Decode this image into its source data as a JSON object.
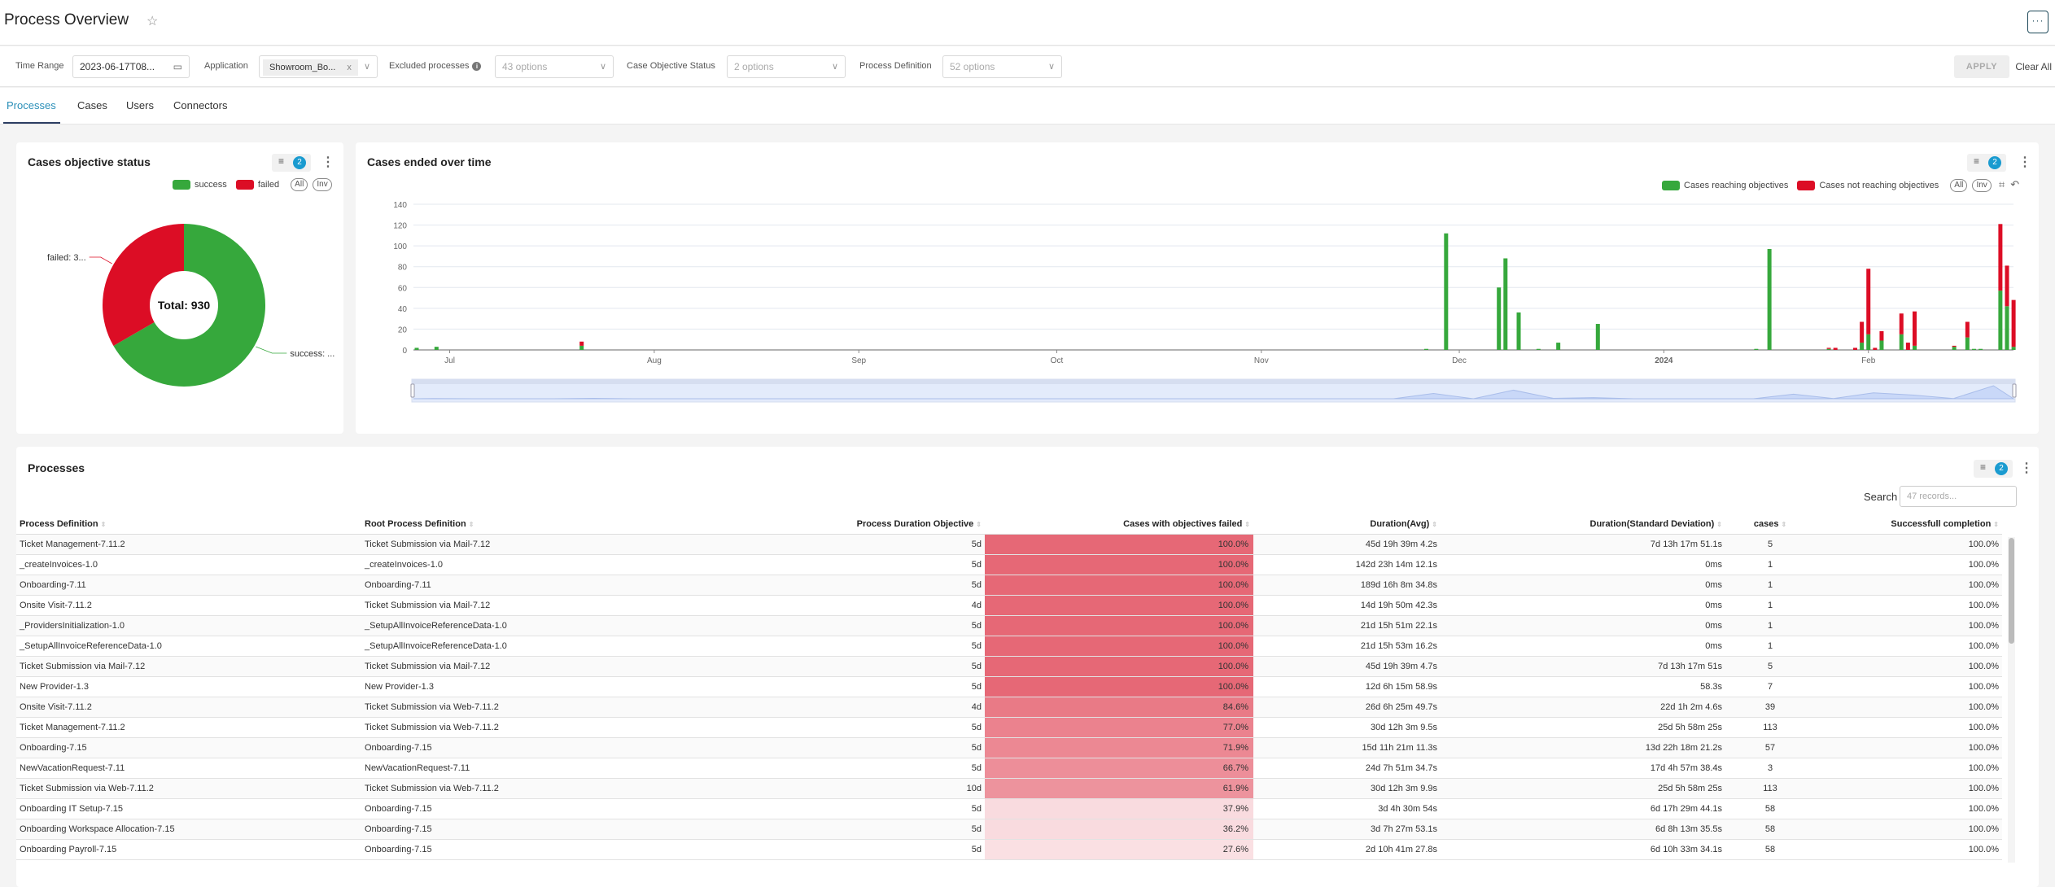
{
  "header": {
    "title": "Process Overview",
    "star_icon": "star-icon",
    "more_label": "···"
  },
  "filters": {
    "time_range": {
      "label": "Time Range",
      "value": "2023-06-17T08..."
    },
    "application": {
      "label": "Application",
      "chip": "Showroom_Bo...",
      "chip_remove": "x"
    },
    "excluded": {
      "label": "Excluded processes",
      "placeholder": "43 options"
    },
    "case_status": {
      "label": "Case Objective Status",
      "placeholder": "2 options"
    },
    "process_def": {
      "label": "Process Definition",
      "placeholder": "52 options"
    },
    "apply_label": "APPLY",
    "clear_label": "Clear All"
  },
  "tabs": [
    {
      "label": "Processes",
      "active": true
    },
    {
      "label": "Cases",
      "active": false
    },
    {
      "label": "Users",
      "active": false
    },
    {
      "label": "Connectors",
      "active": false
    }
  ],
  "objective_card": {
    "title": "Cases objective status",
    "filter_count": "2",
    "legend_all": "All",
    "legend_inv": "Inv"
  },
  "timeline_card": {
    "title": "Cases ended over time",
    "filter_count": "2",
    "legend_all": "All",
    "legend_inv": "Inv"
  },
  "chart_data": [
    {
      "type": "pie",
      "title": "Cases objective status",
      "center_label": "Total: 930",
      "legend": [
        "success",
        "failed"
      ],
      "colors": {
        "success": "#36a83c",
        "failed": "#dc0d25"
      },
      "slices": [
        {
          "name": "success",
          "value": 620,
          "label": "success: ..."
        },
        {
          "name": "failed",
          "value": 310,
          "label": "failed: 3..."
        }
      ]
    },
    {
      "type": "bar",
      "stacked": true,
      "title": "Cases ended over time",
      "xlabel": "",
      "ylabel": "",
      "ylim": [
        0,
        140
      ],
      "yticks": [
        0,
        20,
        40,
        60,
        80,
        100,
        120,
        140
      ],
      "x_range": [
        "2023-06-26",
        "2024-02-22"
      ],
      "xticks": [
        {
          "date": "2023-07-01",
          "label": "Jul"
        },
        {
          "date": "2023-08-01",
          "label": "Aug"
        },
        {
          "date": "2023-09-01",
          "label": "Sep"
        },
        {
          "date": "2023-10-01",
          "label": "Oct"
        },
        {
          "date": "2023-11-01",
          "label": "Nov"
        },
        {
          "date": "2023-12-01",
          "label": "Dec"
        },
        {
          "date": "2024-01-01",
          "label": "2024"
        },
        {
          "date": "2024-02-01",
          "label": "Feb"
        }
      ],
      "grid": true,
      "legend_position": "top-right",
      "series": [
        {
          "name": "Cases reaching objectives",
          "color": "#36a83c"
        },
        {
          "name": "Cases not reaching objectives",
          "color": "#dc0d25"
        }
      ],
      "bars": [
        {
          "date": "2023-06-26",
          "reaching": 2,
          "not_reaching": 0
        },
        {
          "date": "2023-06-29",
          "reaching": 3,
          "not_reaching": 0
        },
        {
          "date": "2023-07-21",
          "reaching": 4,
          "not_reaching": 4
        },
        {
          "date": "2023-11-26",
          "reaching": 1,
          "not_reaching": 0
        },
        {
          "date": "2023-11-29",
          "reaching": 112,
          "not_reaching": 0
        },
        {
          "date": "2023-12-07",
          "reaching": 60,
          "not_reaching": 0
        },
        {
          "date": "2023-12-08",
          "reaching": 88,
          "not_reaching": 0
        },
        {
          "date": "2023-12-10",
          "reaching": 36,
          "not_reaching": 0
        },
        {
          "date": "2023-12-13",
          "reaching": 1,
          "not_reaching": 0
        },
        {
          "date": "2023-12-16",
          "reaching": 7,
          "not_reaching": 0
        },
        {
          "date": "2023-12-22",
          "reaching": 25,
          "not_reaching": 0
        },
        {
          "date": "2024-01-15",
          "reaching": 1,
          "not_reaching": 0
        },
        {
          "date": "2024-01-17",
          "reaching": 97,
          "not_reaching": 0
        },
        {
          "date": "2024-01-26",
          "reaching": 1,
          "not_reaching": 1
        },
        {
          "date": "2024-01-27",
          "reaching": 0,
          "not_reaching": 2
        },
        {
          "date": "2024-01-30",
          "reaching": 0,
          "not_reaching": 2
        },
        {
          "date": "2024-01-31",
          "reaching": 7,
          "not_reaching": 20
        },
        {
          "date": "2024-02-01",
          "reaching": 15,
          "not_reaching": 63
        },
        {
          "date": "2024-02-02",
          "reaching": 0,
          "not_reaching": 2
        },
        {
          "date": "2024-02-03",
          "reaching": 9,
          "not_reaching": 9
        },
        {
          "date": "2024-02-06",
          "reaching": 15,
          "not_reaching": 20
        },
        {
          "date": "2024-02-07",
          "reaching": 0,
          "not_reaching": 7
        },
        {
          "date": "2024-02-08",
          "reaching": 4,
          "not_reaching": 33
        },
        {
          "date": "2024-02-14",
          "reaching": 3,
          "not_reaching": 1
        },
        {
          "date": "2024-02-16",
          "reaching": 12,
          "not_reaching": 15
        },
        {
          "date": "2024-02-17",
          "reaching": 1,
          "not_reaching": 0
        },
        {
          "date": "2024-02-18",
          "reaching": 1,
          "not_reaching": 0
        },
        {
          "date": "2024-02-21",
          "reaching": 57,
          "not_reaching": 64
        },
        {
          "date": "2024-02-22",
          "reaching": 42,
          "not_reaching": 39
        },
        {
          "date": "2024-02-23",
          "reaching": 3,
          "not_reaching": 45
        }
      ]
    }
  ],
  "processes_card": {
    "title": "Processes",
    "filter_count": "2",
    "search_label": "Search",
    "search_placeholder": "47 records...",
    "columns": [
      "Process Definition",
      "Root Process Definition",
      "Process Duration Objective",
      "Cases with objectives failed",
      "Duration(Avg)",
      "Duration(Standard Deviation)",
      "cases",
      "Successfull completion"
    ],
    "rows": [
      [
        "Ticket Management-7.11.2",
        "Ticket Submission via Mail-7.12",
        "5d",
        "100.0%",
        "45d 19h 39m 4.2s",
        "7d 13h 17m 51.1s",
        "5",
        "100.0%"
      ],
      [
        "_createInvoices-1.0",
        "_createInvoices-1.0",
        "5d",
        "100.0%",
        "142d 23h 14m 12.1s",
        "0ms",
        "1",
        "100.0%"
      ],
      [
        "Onboarding-7.11",
        "Onboarding-7.11",
        "5d",
        "100.0%",
        "189d 16h 8m 34.8s",
        "0ms",
        "1",
        "100.0%"
      ],
      [
        "Onsite Visit-7.11.2",
        "Ticket Submission via Mail-7.12",
        "4d",
        "100.0%",
        "14d 19h 50m 42.3s",
        "0ms",
        "1",
        "100.0%"
      ],
      [
        "_ProvidersInitialization-1.0",
        "_SetupAllInvoiceReferenceData-1.0",
        "5d",
        "100.0%",
        "21d 15h 51m 22.1s",
        "0ms",
        "1",
        "100.0%"
      ],
      [
        "_SetupAllInvoiceReferenceData-1.0",
        "_SetupAllInvoiceReferenceData-1.0",
        "5d",
        "100.0%",
        "21d 15h 53m 16.2s",
        "0ms",
        "1",
        "100.0%"
      ],
      [
        "Ticket Submission via Mail-7.12",
        "Ticket Submission via Mail-7.12",
        "5d",
        "100.0%",
        "45d 19h 39m 4.7s",
        "7d 13h 17m 51s",
        "5",
        "100.0%"
      ],
      [
        "New Provider-1.3",
        "New Provider-1.3",
        "5d",
        "100.0%",
        "12d 6h 15m 58.9s",
        "58.3s",
        "7",
        "100.0%"
      ],
      [
        "Onsite Visit-7.11.2",
        "Ticket Submission via Web-7.11.2",
        "4d",
        "84.6%",
        "26d 6h 25m 49.7s",
        "22d 1h 2m 4.6s",
        "39",
        "100.0%"
      ],
      [
        "Ticket Management-7.11.2",
        "Ticket Submission via Web-7.11.2",
        "5d",
        "77.0%",
        "30d 12h 3m 9.5s",
        "25d 5h 58m 25s",
        "113",
        "100.0%"
      ],
      [
        "Onboarding-7.15",
        "Onboarding-7.15",
        "5d",
        "71.9%",
        "15d 11h 21m 11.3s",
        "13d 22h 18m 21.2s",
        "57",
        "100.0%"
      ],
      [
        "NewVacationRequest-7.11",
        "NewVacationRequest-7.11",
        "5d",
        "66.7%",
        "24d 7h 51m 34.7s",
        "17d 4h 57m 38.4s",
        "3",
        "100.0%"
      ],
      [
        "Ticket Submission via Web-7.11.2",
        "Ticket Submission via Web-7.11.2",
        "10d",
        "61.9%",
        "30d 12h 3m 9.9s",
        "25d 5h 58m 25s",
        "113",
        "100.0%"
      ],
      [
        "Onboarding IT Setup-7.15",
        "Onboarding-7.15",
        "5d",
        "37.9%",
        "3d 4h 30m 54s",
        "6d 17h 29m 44.1s",
        "58",
        "100.0%"
      ],
      [
        "Onboarding Workspace Allocation-7.15",
        "Onboarding-7.15",
        "5d",
        "36.2%",
        "3d 7h 27m 53.1s",
        "6d 8h 13m 35.5s",
        "58",
        "100.0%"
      ],
      [
        "Onboarding Payroll-7.15",
        "Onboarding-7.15",
        "5d",
        "27.6%",
        "2d 10h 41m 27.8s",
        "6d 10h 33m 34.1s",
        "58",
        "100.0%"
      ]
    ],
    "heat_colors": {
      "high": "#ec959f",
      "mid": "#efaab3",
      "low": "#f7d4d9"
    }
  }
}
